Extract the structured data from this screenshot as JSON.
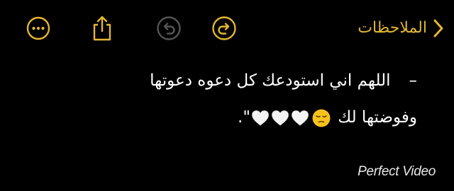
{
  "toolbar": {
    "back_label": "الملاحظات",
    "back_icon": "chevron-left-icon",
    "more_icon": "ellipsis-circle-icon",
    "share_icon": "share-icon",
    "undo_icon": "undo-icon",
    "redo_icon": "redo-icon",
    "accent_color": "#E5B72E",
    "disabled_color": "#555555"
  },
  "note": {
    "bullet": "–",
    "line1": "اللهم اني استودعك كل دعوه دعوتها",
    "line2_text": "وفوضتها لك",
    "line2_end": "\".",
    "emoji": [
      "pensive-face-emoji",
      "white-heart-emoji",
      "white-heart-emoji",
      "white-heart-emoji"
    ]
  },
  "watermark": {
    "text": "Perfect Video"
  }
}
